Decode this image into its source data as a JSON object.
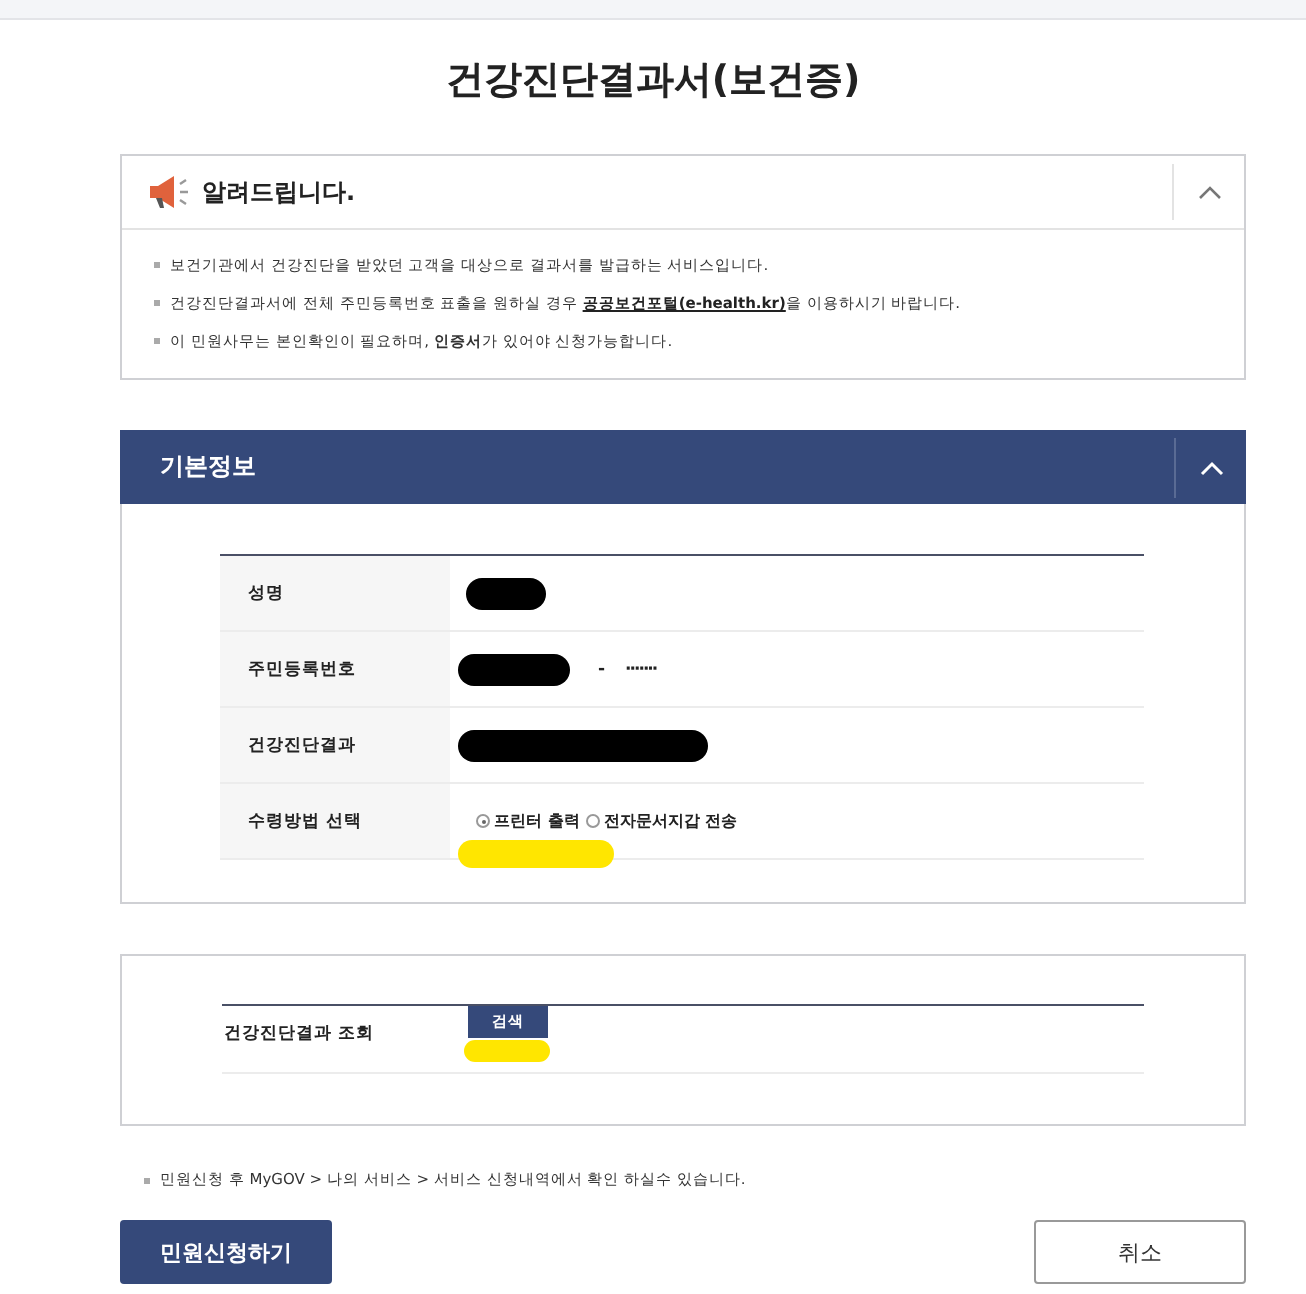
{
  "title": "건강진단결과서(보건증)",
  "notice": {
    "title": "알려드립니다.",
    "expanded": true,
    "items": [
      {
        "text": "보건기관에서 건강진단을 받았던 고객을 대상으로 결과서를 발급하는 서비스입니다."
      },
      {
        "text": "건강진단결과서에 전체 주민등록번호 표출을 원하실 경우 ",
        "link": "공공보건포털(e-health.kr)",
        "after": "을 이용하시기 바랍니다."
      },
      {
        "text": "이 민원사무는 본인확인이 필요하며, **인증서**가 있어야 신청가능합니다."
      }
    ]
  },
  "basic_info": {
    "title": "기본정보",
    "expanded": true,
    "rows": [
      {
        "kind": "redacted",
        "label": "성명",
        "redacted": true
      },
      {
        "kind": "id",
        "label": "주민등록번호",
        "redacted": true,
        "separator": "-",
        "masked": "·······"
      },
      {
        "kind": "redacted",
        "label": "건강진단결과",
        "redacted": true
      },
      {
        "kind": "radio",
        "label": "수령방법 선택",
        "highlighted": true,
        "options": [
          {
            "label": "프린터 출력",
            "selected": true
          },
          {
            "label": "전자문서지갑 전송",
            "selected": false
          }
        ]
      }
    ]
  },
  "lookup": {
    "label": "건강진단결과 조회",
    "button": "검색",
    "highlighted": true
  },
  "footnote": "민원신청 후 MyGOV > 나의 서비스 > 서비스 신청내역에서 확인 하실수 있습니다.",
  "buttons": [
    {
      "label": "민원신청하기",
      "kind": "primary"
    },
    {
      "label": "취소",
      "kind": "secondary"
    }
  ]
}
